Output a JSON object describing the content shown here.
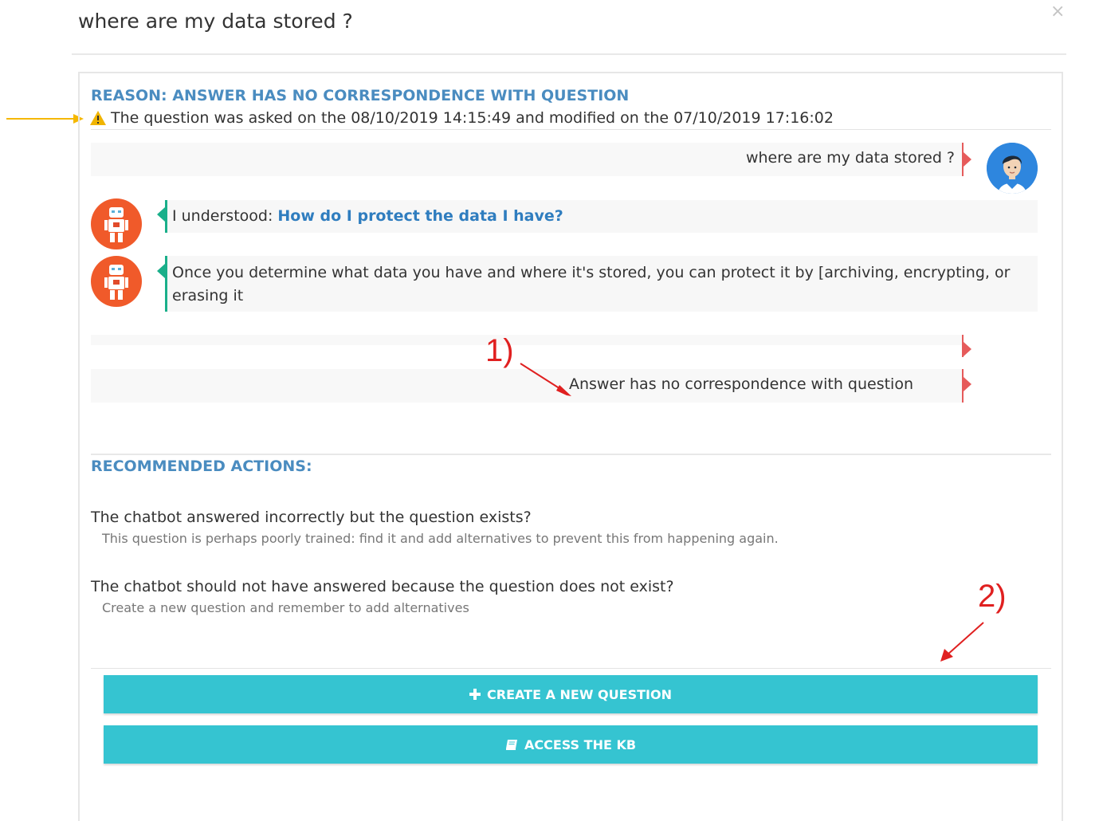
{
  "modal": {
    "title": "where are my data stored ?",
    "close_label": "×"
  },
  "report": {
    "reason": "REASON: ANSWER HAS NO CORRESPONDENCE WITH QUESTION",
    "meta": "The question was asked on the 08/10/2019 14:15:49 and modified on the 07/10/2019 17:16:02"
  },
  "conversation": {
    "user_message": "where are my data stored ?",
    "understood_prefix": "I understood: ",
    "understood_question": "How do I protect the data I have?",
    "answer_line1": "Once you determine what data you have and where it's stored, you can protect it by [archiving, encrypting, or",
    "answer_line2": "erasing it",
    "feedback_empty": "",
    "feedback_reason": "Answer has no correspondence with question"
  },
  "annotations": {
    "one": "1)",
    "two": "2)"
  },
  "recommended": {
    "title": "RECOMMENDED ACTIONS:",
    "items": [
      {
        "question": "The chatbot answered incorrectly but the question exists?",
        "hint": "This question is perhaps poorly trained: find it and add alternatives to prevent this from happening again."
      },
      {
        "question": "The chatbot should not have answered because the question does not exist?",
        "hint": "Create a new question and remember to add alternatives"
      }
    ]
  },
  "buttons": {
    "create": "CREATE A NEW QUESTION",
    "access": "ACCESS THE KB"
  },
  "colors": {
    "accent_blue": "#4a8cc0",
    "button_teal": "#35c4d1",
    "user_marker": "#e65b5b",
    "bot_marker": "#1aaf8a",
    "annotation_red": "#e02020",
    "annotation_arrow_orange": "#f5b800"
  },
  "icons": {
    "warning": "warning-icon",
    "plus": "plus-icon",
    "book": "book-icon",
    "user_avatar": "user-avatar-icon",
    "bot_avatar": "robot-avatar-icon"
  }
}
